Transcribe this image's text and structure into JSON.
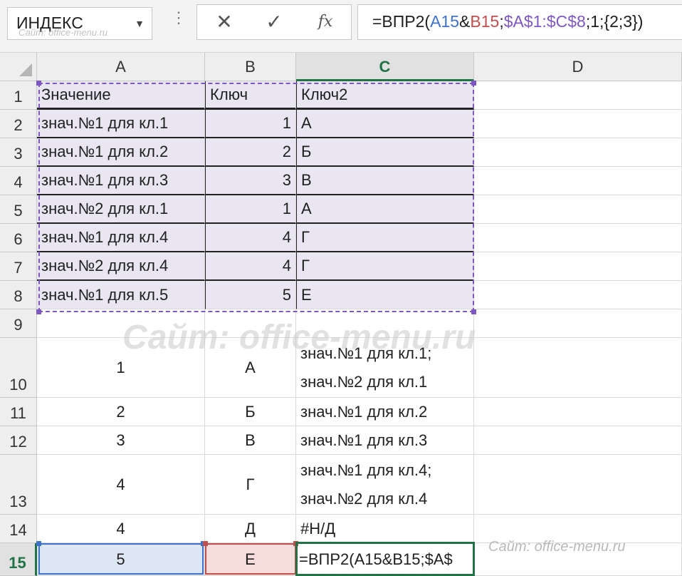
{
  "namebox": {
    "value": "ИНДЕКС",
    "watermark": "Сайт: office-menu.ru"
  },
  "fx_buttons": {
    "cancel": "✕",
    "enter": "✓",
    "insert_function": "fx"
  },
  "formula": {
    "prefix": "=ВПР2(",
    "ref_a": "A15",
    "amp": "&",
    "ref_b": "B15",
    "sep1": ";",
    "ref_range": "$A$1:$C$8",
    "suffix": ";1;{2;3})"
  },
  "columns": [
    "A",
    "B",
    "C",
    "D"
  ],
  "rows": [
    "1",
    "2",
    "3",
    "4",
    "5",
    "6",
    "7",
    "8",
    "9",
    "10",
    "11",
    "12",
    "13",
    "14",
    "15"
  ],
  "table": {
    "header": [
      "Значение",
      "Ключ",
      "Ключ2"
    ],
    "data": [
      [
        "знач.№1 для кл.1",
        "1",
        "А"
      ],
      [
        "знач.№1 для кл.2",
        "2",
        "Б"
      ],
      [
        "знач.№1 для кл.3",
        "3",
        "В"
      ],
      [
        "знач.№2 для кл.1",
        "1",
        "А"
      ],
      [
        "знач.№1 для кл.4",
        "4",
        "Г"
      ],
      [
        "знач.№2 для кл.4",
        "4",
        "Г"
      ],
      [
        "знач.№1 для кл.5",
        "5",
        "Е"
      ]
    ]
  },
  "results": [
    {
      "a": "1",
      "b": "А",
      "c1": "знач.№1 для кл.1;",
      "c2": "знач.№2 для кл.1"
    },
    {
      "a": "2",
      "b": "Б",
      "c1": "знач.№1 для кл.2",
      "c2": ""
    },
    {
      "a": "3",
      "b": "В",
      "c1": "знач.№1 для кл.3",
      "c2": ""
    },
    {
      "a": "4",
      "b": "Г",
      "c1": "знач.№1 для кл.4;",
      "c2": "знач.№2 для кл.4"
    },
    {
      "a": "4",
      "b": "Д",
      "c1": "#Н/Д",
      "c2": ""
    },
    {
      "a": "5",
      "b": "Е",
      "c1": "=ВПР2(A15&B15;$A$",
      "c2": ""
    }
  ],
  "watermark": "Сайт: office-menu.ru",
  "colors": {
    "accent": "#217346",
    "ref_a": "#3e73c9",
    "ref_b": "#c0504d",
    "ref_c": "#7e57c2",
    "table_fill": "#e9e6f1"
  }
}
